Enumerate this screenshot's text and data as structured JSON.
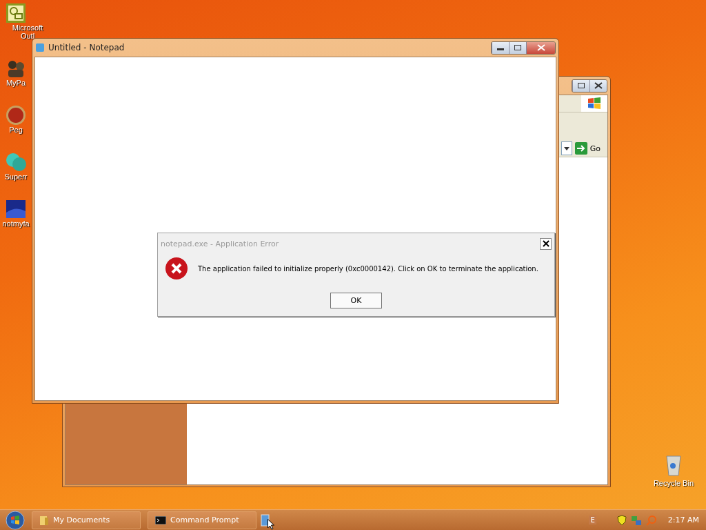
{
  "desktop_icons": [
    {
      "label": "Microsoft Outl",
      "kind": "calendar"
    },
    {
      "label": "MyPa",
      "kind": "people"
    },
    {
      "label": "Peg",
      "kind": "ball"
    },
    {
      "label": "Superr",
      "kind": "bubble"
    },
    {
      "label": "notmyfa",
      "kind": "screen"
    }
  ],
  "recycle_bin": {
    "label": "Recycle Bin"
  },
  "back_window": {
    "address_button": "Go"
  },
  "notepad": {
    "title": "Untitled - Notepad"
  },
  "dialog": {
    "title": "notepad.exe - Application Error",
    "message": "The application failed to initialize properly (0xc0000142). Click on OK to terminate the application.",
    "button": "OK"
  },
  "taskbar": {
    "items": [
      {
        "label": "My Documents",
        "kind": "folder"
      },
      {
        "label": "Command Prompt",
        "kind": "console"
      }
    ],
    "language": "E",
    "clock": "2:17 AM"
  }
}
